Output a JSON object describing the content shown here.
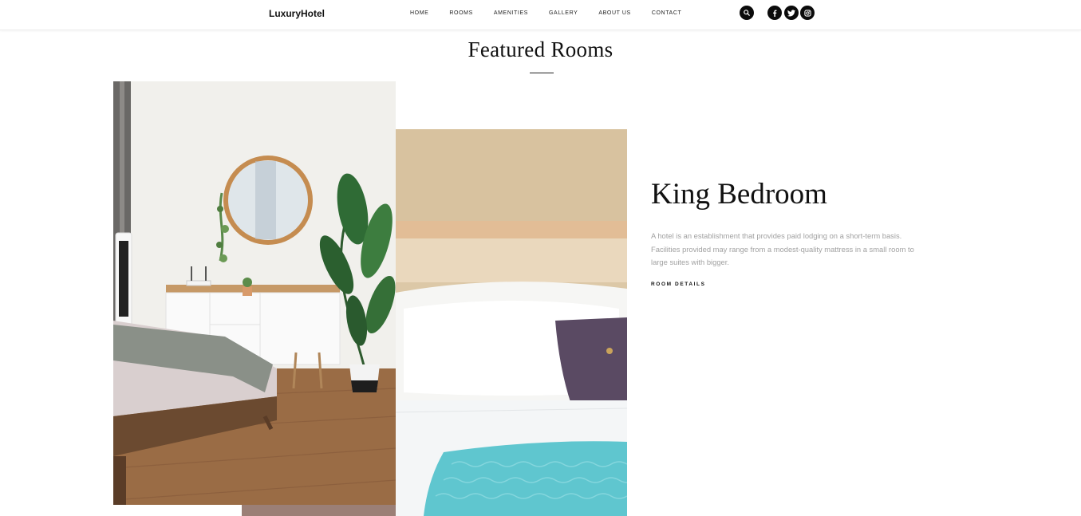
{
  "header": {
    "logo": "LuxuryHotel",
    "nav": [
      {
        "label": "HOME"
      },
      {
        "label": "ROOMS"
      },
      {
        "label": "AMENITIES"
      },
      {
        "label": "GALLERY"
      },
      {
        "label": "ABOUT US"
      },
      {
        "label": "CONTACT"
      }
    ],
    "search_icon": "search-icon",
    "social": [
      {
        "icon": "facebook-icon"
      },
      {
        "icon": "twitter-icon"
      },
      {
        "icon": "instagram-icon"
      }
    ]
  },
  "featured": {
    "title": "Featured Rooms",
    "photos": [
      {
        "subject": "bedroom-with-mirror-and-plant"
      },
      {
        "subject": "bed-with-pillows-and-teal-throw"
      }
    ],
    "room": {
      "name": "King Bedroom",
      "description": "A hotel is an establishment that provides paid lodging on a short-term basis. Facilities provided may range from a modest-quality mattress in a small room to large suites with bigger.",
      "link_label": "ROOM DETAILS"
    }
  },
  "colors": {
    "text": "#111111",
    "muted": "#a1a1a1",
    "icon_bg": "#0b0b0b",
    "accent_teal": "#5fc6cf"
  }
}
